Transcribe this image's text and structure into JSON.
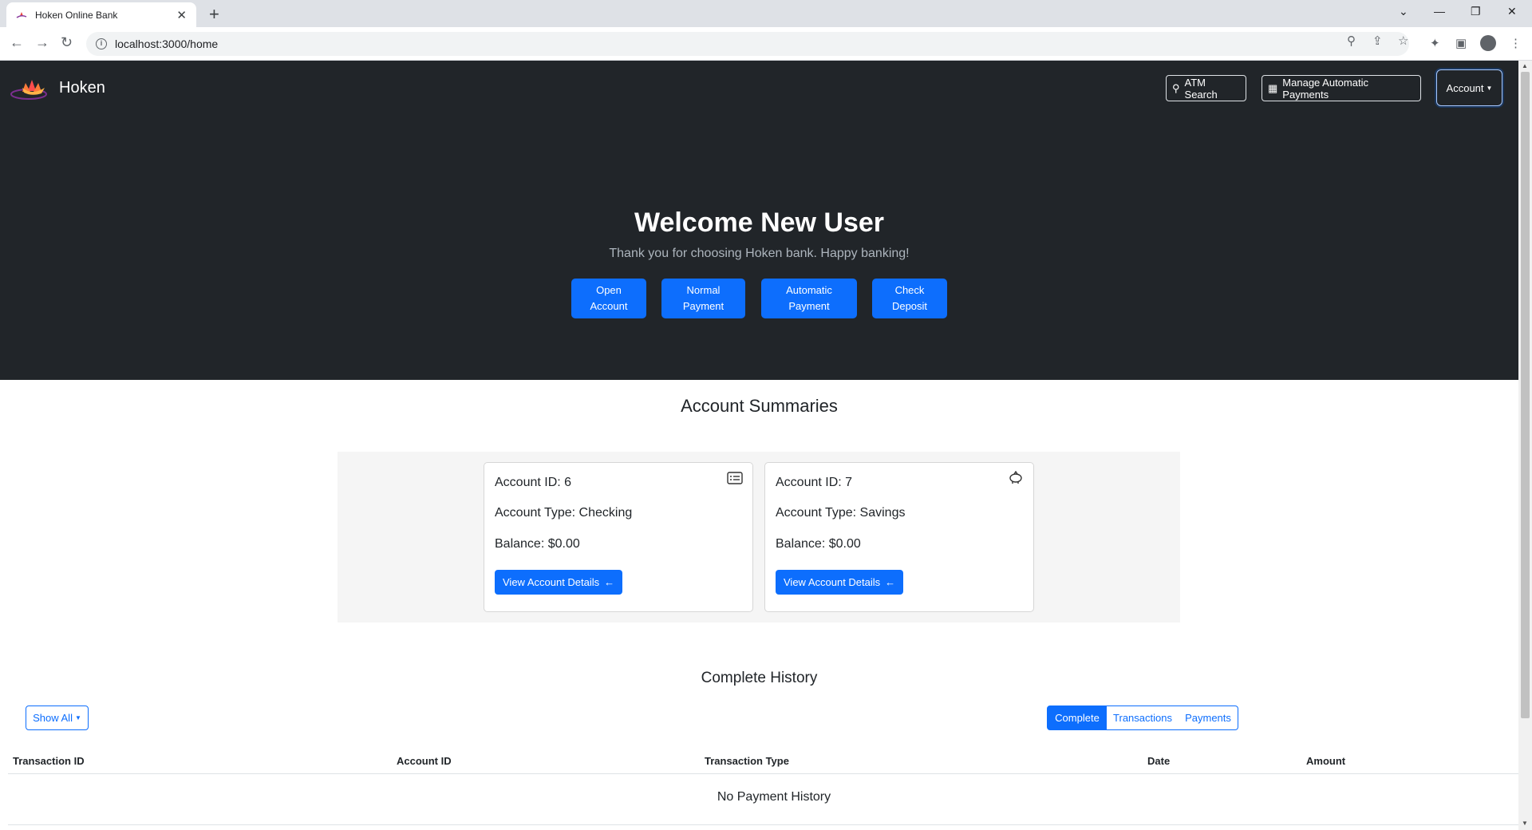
{
  "browser": {
    "tab_title": "Hoken Online Bank",
    "tab_close": "✕",
    "new_tab": "+",
    "url": "localhost:3000/home"
  },
  "navbar": {
    "brand": "Hoken",
    "atm_search": "ATM Search",
    "manage_payments": "Manage Automatic Payments",
    "account": "Account"
  },
  "hero": {
    "title": "Welcome New User",
    "subtitle": "Thank you for choosing Hoken bank. Happy banking!",
    "buttons": [
      {
        "line1": "Open",
        "line2": "Account"
      },
      {
        "line1": "Normal",
        "line2": "Payment"
      },
      {
        "line1": "Automatic",
        "line2": "Payment"
      },
      {
        "line1": "Check",
        "line2": "Deposit"
      }
    ]
  },
  "summaries": {
    "title": "Account Summaries",
    "cards": [
      {
        "id": "Account ID: 6",
        "type": "Account Type: Checking",
        "balance": "Balance: $0.00",
        "button": "View Account Details",
        "icon": "card-list-icon"
      },
      {
        "id": "Account ID: 7",
        "type": "Account Type: Savings",
        "balance": "Balance: $0.00",
        "button": "View Account Details",
        "icon": "piggy-bank-icon"
      }
    ]
  },
  "history": {
    "title": "Complete History",
    "filter": "Show All",
    "tabs": [
      "Complete",
      "Transactions",
      "Payments"
    ],
    "active_tab": "Complete",
    "columns": [
      "Transaction ID",
      "Account ID",
      "Transaction Type",
      "Date",
      "Amount"
    ],
    "empty_message": "No Payment History"
  },
  "colors": {
    "hero_bg": "#212529",
    "primary": "#0d6efd",
    "panel_bg": "#f5f5f5"
  }
}
